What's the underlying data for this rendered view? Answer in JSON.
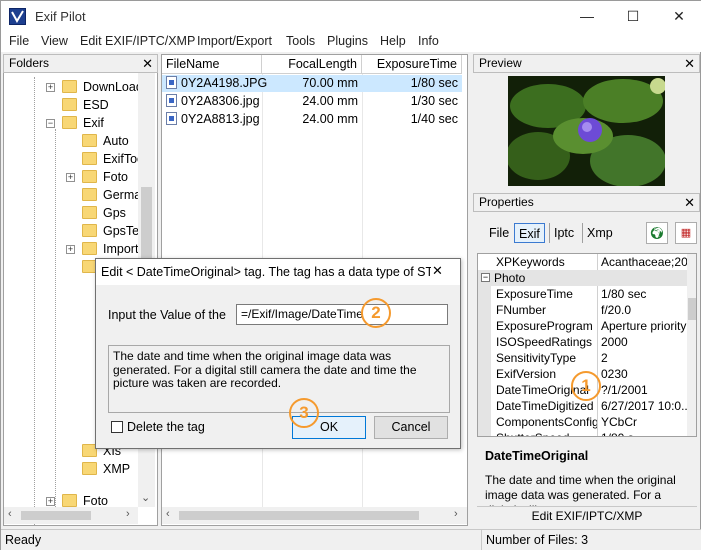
{
  "window": {
    "title": "Exif Pilot",
    "minimize": "—",
    "maximize": "☐",
    "close": "✕"
  },
  "menu": [
    "File",
    "View",
    "Edit EXIF/IPTC/XMP",
    "Import/Export",
    "Tools",
    "Plugins",
    "Help",
    "Info"
  ],
  "folders": {
    "title": "Folders",
    "items": [
      "DownLoad",
      "ESD",
      "Exif",
      "Auto",
      "ExifToo",
      "Foto",
      "Germa",
      "Gps",
      "GpsTes",
      "Import",
      "XIs",
      "XMP",
      "Foto"
    ]
  },
  "files": {
    "columns": [
      "FileName",
      "FocalLength",
      "ExposureTime"
    ],
    "rows": [
      {
        "name": "0Y2A4198.JPG",
        "focal": "70.00 mm",
        "exposure": "1/80 sec"
      },
      {
        "name": "0Y2A8306.jpg",
        "focal": "24.00 mm",
        "exposure": "1/30 sec"
      },
      {
        "name": "0Y2A8813.jpg",
        "focal": "24.00 mm",
        "exposure": "1/40 sec"
      }
    ]
  },
  "preview": {
    "title": "Preview"
  },
  "properties": {
    "title": "Properties",
    "tabs": [
      "File",
      "Exif",
      "Iptc",
      "Xmp"
    ],
    "active_tab": "Exif",
    "top_row": {
      "key": "XPKeywords",
      "value": "Acanthaceae;20..."
    },
    "group": "Photo",
    "rows": [
      {
        "key": "ExposureTime",
        "value": "1/80 sec"
      },
      {
        "key": "FNumber",
        "value": "f/20.0"
      },
      {
        "key": "ExposureProgram",
        "value": "Aperture priority"
      },
      {
        "key": "ISOSpeedRatings",
        "value": "2000"
      },
      {
        "key": "SensitivityType",
        "value": "2"
      },
      {
        "key": "ExifVersion",
        "value": "0230"
      },
      {
        "key": "DateTimeOriginal",
        "value": "?/1/2001"
      },
      {
        "key": "DateTimeDigitized",
        "value": "6/27/2017 10:0..."
      },
      {
        "key": "ComponentsConfiguration",
        "value": "YCbCr"
      },
      {
        "key": "ShutterSpeed",
        "value": "1/80 s"
      }
    ],
    "desc_title": "DateTimeOriginal",
    "desc_text": "The date and time when the original image data was generated. For a digital still camera",
    "edit_button": "Edit EXIF/IPTC/XMP"
  },
  "dialog": {
    "title": "Edit < DateTimeOriginal> tag. The tag has a data type of STR...",
    "close": "✕",
    "input_label": "Input the Value of the",
    "input_value": "=/Exif/Image/DateTime",
    "description": "The date and time when the original image data was generated. For a digital still camera the date and time the picture was taken are recorded.",
    "delete_label": "Delete the tag",
    "ok": "OK",
    "cancel": "Cancel"
  },
  "badges": [
    "1",
    "2",
    "3"
  ],
  "status": {
    "left": "Ready",
    "right": "Number of Files: 3"
  },
  "colors": {
    "accent": "#f59a2e",
    "selection": "#cce8ff"
  }
}
